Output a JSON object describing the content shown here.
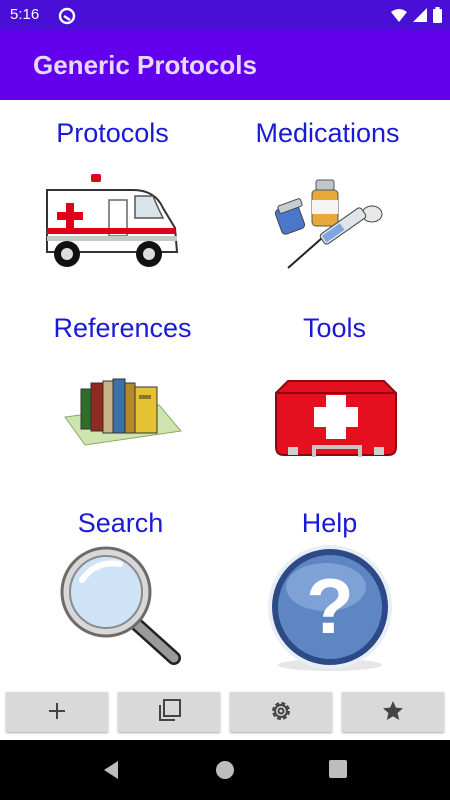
{
  "status_bar": {
    "time": "5:16"
  },
  "app_bar": {
    "title": "Generic Protocols"
  },
  "grid": {
    "items": [
      {
        "label": "Protocols",
        "icon": "ambulance-icon"
      },
      {
        "label": "Medications",
        "icon": "syringe-vials-icon"
      },
      {
        "label": "References",
        "icon": "books-icon"
      },
      {
        "label": "Tools",
        "icon": "first-aid-kit-icon"
      },
      {
        "label": "Search",
        "icon": "magnifier-icon"
      },
      {
        "label": "Help",
        "icon": "help-question-icon"
      }
    ]
  },
  "toolbar": {
    "buttons": [
      "add-icon",
      "copy-icon",
      "settings-icon",
      "star-icon"
    ]
  },
  "nav_bar": {
    "buttons": [
      "back-icon",
      "home-icon",
      "recents-icon"
    ]
  },
  "colors": {
    "status_bar": "#4a0fd6",
    "app_bar": "#6200ee",
    "title_text": "#e6d9ff",
    "label_text": "#1a1ad6",
    "toolbar_button": "#d9d9d9"
  }
}
